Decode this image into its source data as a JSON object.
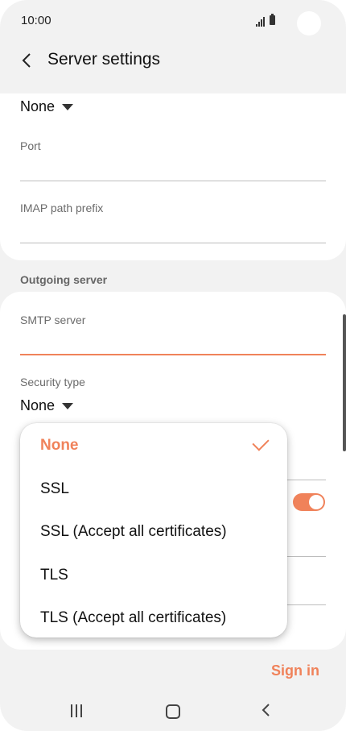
{
  "status_bar": {
    "time": "10:00"
  },
  "header": {
    "title": "Server settings",
    "back_icon": "chevron-left-icon"
  },
  "incoming": {
    "security_value": "None",
    "port_label": "Port",
    "imap_prefix_label": "IMAP path prefix"
  },
  "outgoing": {
    "section_title": "Outgoing server",
    "smtp_label": "SMTP server",
    "security_label": "Security type",
    "security_value": "None",
    "auth_toggle_on": true
  },
  "security_dropdown": {
    "options": [
      {
        "label": "None",
        "selected": true
      },
      {
        "label": "SSL",
        "selected": false
      },
      {
        "label": "SSL (Accept all certificates)",
        "selected": false
      },
      {
        "label": "TLS",
        "selected": false
      },
      {
        "label": "TLS (Accept all certificates)",
        "selected": false
      }
    ]
  },
  "footer": {
    "sign_in_label": "Sign in"
  },
  "colors": {
    "accent": "#f0825a",
    "background": "#f2f2f2",
    "card": "#ffffff"
  }
}
